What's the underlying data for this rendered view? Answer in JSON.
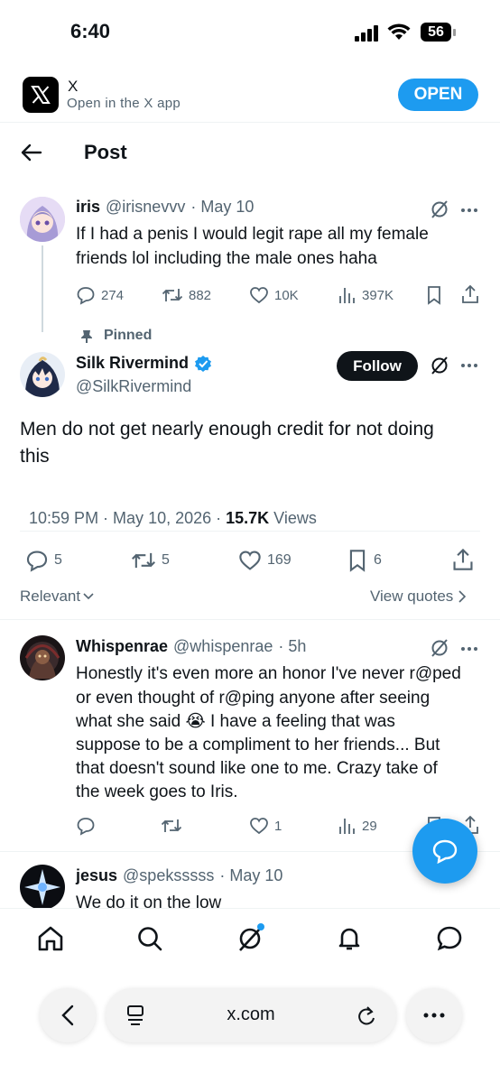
{
  "status_bar": {
    "time": "6:40",
    "battery": "56"
  },
  "app_banner": {
    "app_name": "X",
    "subtitle": "Open in the X app",
    "open_label": "OPEN"
  },
  "header": {
    "title": "Post"
  },
  "parent_tweet": {
    "name": "iris",
    "handle": "@irisnevvv",
    "date": "· May 10",
    "text_line1": "If I had a penis I would legit rape all my female",
    "text_line2": "friends lol including the male ones haha",
    "replies": "274",
    "reposts": "882",
    "likes": "10K",
    "views": "397K"
  },
  "main_tweet": {
    "pinned_label": "Pinned",
    "name": "Silk Rivermind",
    "handle": "@SilkRivermind",
    "follow_label": "Follow",
    "text_line1": "Men do not get nearly enough credit for not doing",
    "text_line2": "this",
    "timestamp": "10:59 PM · May 10, 2026 · ",
    "views_count": "15.7K",
    "views_label": " Views",
    "replies": "5",
    "reposts": "5",
    "likes": "169",
    "bookmarks": "6"
  },
  "sort": {
    "relevant_label": "Relevant",
    "view_quotes_label": "View quotes"
  },
  "reply_1": {
    "name": "Whispenrae",
    "handle": "@whispenrae",
    "time": "· 5h",
    "lines": [
      "Honestly it's even more an honor I've never r@ped",
      "or even thought of r@ping anyone after seeing",
      "what she said 😭 I have a feeling that was",
      "suppose to be a compliment to her friends... But",
      "that doesn't sound like one to me. Crazy take of",
      "the week goes to Iris."
    ],
    "likes": "1",
    "views": "29"
  },
  "reply_2": {
    "name": "jesus",
    "handle": "@speksssss",
    "date": "· May 10",
    "text": "We do it on the low"
  },
  "browser": {
    "url": "x.com"
  },
  "colors": {
    "accent": "#1d9bf0",
    "text": "#0f1419",
    "secondary": "#536471"
  }
}
